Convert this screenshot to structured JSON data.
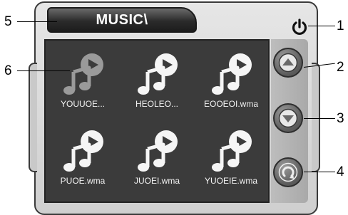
{
  "header": {
    "title": "MUSIC\\"
  },
  "files": [
    {
      "name": "YOUUOE..."
    },
    {
      "name": "HEOLEO..."
    },
    {
      "name": "EOOEOI.wma"
    },
    {
      "name": "PUOE.wma"
    },
    {
      "name": "JUOEI.wma"
    },
    {
      "name": "YUOEIE.wma"
    }
  ],
  "callouts": {
    "c1": "1",
    "c2": "2",
    "c3": "3",
    "c4": "4",
    "c5": "5",
    "c6": "6"
  },
  "icons": {
    "power": "power-icon",
    "up": "arrow-up-icon",
    "down": "arrow-down-icon",
    "back": "rotate-back-icon",
    "file": "music-file-icon"
  },
  "colors": {
    "panel": "#3b3b3b",
    "icon": "#f5f5f5",
    "selected_icon": "#9a9a9a"
  },
  "selected_index": 0
}
